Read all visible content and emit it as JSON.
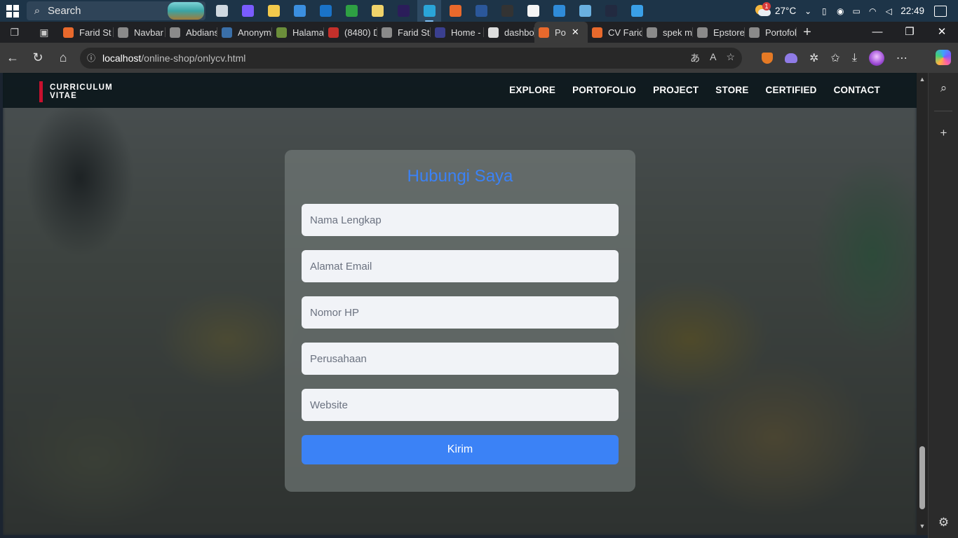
{
  "taskbar": {
    "search_label": "Search",
    "apps": [
      {
        "name": "task-view",
        "color": "#cfd8e0"
      },
      {
        "name": "copilot",
        "color": "#7a5cff"
      },
      {
        "name": "file-explorer",
        "color": "#f2c94c"
      },
      {
        "name": "microsoft-store",
        "color": "#3b8fe0"
      },
      {
        "name": "outlook",
        "color": "#1a73c8"
      },
      {
        "name": "excel-chart",
        "color": "#2ea043"
      },
      {
        "name": "linux-penguin",
        "color": "#f0d36a"
      },
      {
        "name": "after-effects",
        "color": "#2b1d5a"
      },
      {
        "name": "edge",
        "color": "#2aa5d8"
      },
      {
        "name": "xampp",
        "color": "#e8692c"
      },
      {
        "name": "word",
        "color": "#2b579a"
      },
      {
        "name": "terminal",
        "color": "#333333"
      },
      {
        "name": "notion",
        "color": "#f5f5f5"
      },
      {
        "name": "vscode",
        "color": "#2f8bd8"
      },
      {
        "name": "photos",
        "color": "#6ab0e0"
      },
      {
        "name": "fox-app",
        "color": "#222a40"
      },
      {
        "name": "paint",
        "color": "#3aa0e8"
      }
    ],
    "weather_badge": "1",
    "temperature": "27°C",
    "time": "22:49"
  },
  "tabs": [
    {
      "label": "Farid St",
      "favicon": "#e8692c"
    },
    {
      "label": "Navbar",
      "favicon": "#8a8a8a"
    },
    {
      "label": "Abdians",
      "favicon": "#8a8a8a"
    },
    {
      "label": "Anonym",
      "favicon": "#3a6fa8"
    },
    {
      "label": "Halama",
      "favicon": "#6b8e3a"
    },
    {
      "label": "(8480) D",
      "favicon": "#c4302b"
    },
    {
      "label": "Farid St",
      "favicon": "#8a8a8a"
    },
    {
      "label": "Home -",
      "favicon": "#3a3f8f"
    },
    {
      "label": "dashbo",
      "favicon": "#dddddd"
    },
    {
      "label": "Po",
      "favicon": "#e8692c",
      "active": true
    },
    {
      "label": "CV Faric",
      "favicon": "#e8692c"
    },
    {
      "label": "spek m",
      "favicon": "#8a8a8a"
    },
    {
      "label": "Epstore",
      "favicon": "#8a8a8a"
    },
    {
      "label": "Portofol",
      "favicon": "#8a8a8a"
    }
  ],
  "address": {
    "host": "localhost",
    "path": "/online-shop/onlycv.html"
  },
  "page": {
    "brand_line1": "CURRICULUM",
    "brand_line2": "VITAE",
    "nav": [
      "EXPLORE",
      "PORTOFOLIO",
      "PROJECT",
      "STORE",
      "CERTIFIED",
      "CONTACT"
    ],
    "form": {
      "title": "Hubungi Saya",
      "fields": {
        "name": "Nama Lengkap",
        "email": "Alamat Email",
        "phone": "Nomor HP",
        "company": "Perusahaan",
        "website": "Website"
      },
      "submit_label": "Kirim"
    }
  },
  "colors": {
    "accent": "#3b82f6",
    "brand_bar": "#c8102e"
  }
}
